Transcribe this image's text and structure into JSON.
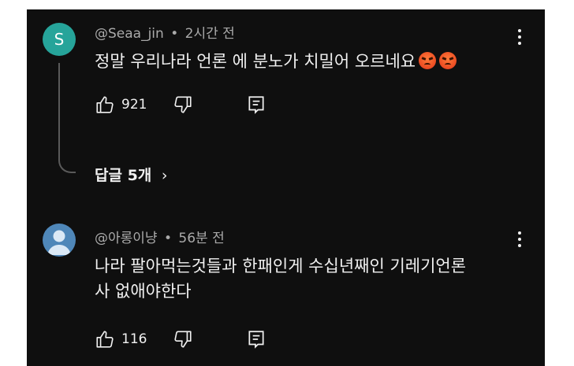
{
  "comments": [
    {
      "avatar_letter": "S",
      "author": "@Seaa_jin",
      "separator": "•",
      "time": "2시간 전",
      "text_lines": [
        "정말 우리나라 언론 에 분노가 치밀어 오르네요"
      ],
      "emojis": [
        "angry-face",
        "angry-face"
      ],
      "likes": "921",
      "replies_label": "답글 5개",
      "replies_chevron": "›"
    },
    {
      "avatar": "default-profile",
      "author": "@아롱이냥",
      "separator": "•",
      "time": "56분 전",
      "text_lines": [
        "나라 팔아먹는것들과 한패인게 수십년째인 기레기언론",
        "사 없애야한다"
      ],
      "likes": "116"
    }
  ],
  "colors": {
    "background": "#0f0f0f",
    "avatar_s": "#26a49a",
    "avatar_default": "#4f87b9",
    "primary_text": "#f1f1f1",
    "secondary_text": "#aaaaaa"
  }
}
